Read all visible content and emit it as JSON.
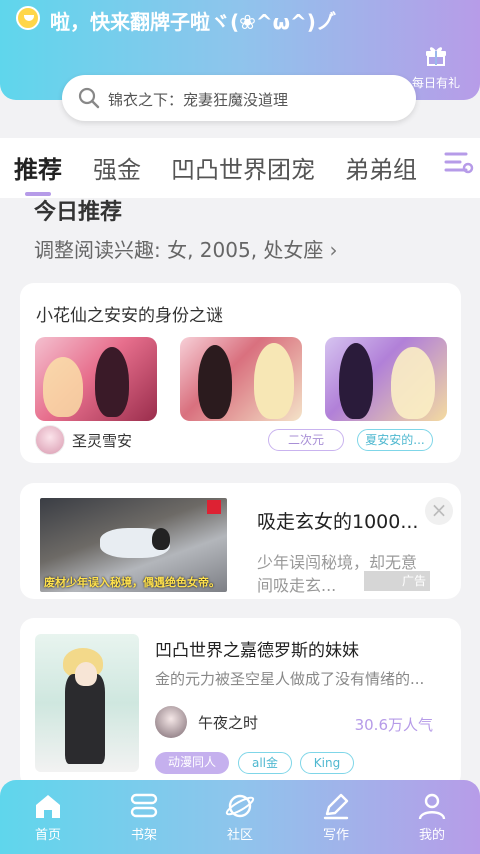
{
  "header": {
    "slogan": "啦，快来翻牌子啦ヾ(❀^ω^)ノ゙",
    "gift_label": "每日有礼"
  },
  "search": {
    "placeholder": "锦衣之下：宠妻狂魔没道理"
  },
  "tabs": [
    {
      "label": "推荐",
      "active": true
    },
    {
      "label": "强金",
      "active": false
    },
    {
      "label": "凹凸世界团宠",
      "active": false
    },
    {
      "label": "弟弟组",
      "active": false
    }
  ],
  "today": {
    "title": "今日推荐",
    "subtitle": "调整阅读兴趣: 女, 2005, 处女座"
  },
  "collection": {
    "title": "小花仙之安安的身份之谜",
    "author": "圣灵雪安",
    "tags": [
      "二次元",
      "夏安安的..."
    ]
  },
  "ad": {
    "title": "吸走玄女的1000...",
    "desc": "少年误闯秘境，却无意间吸走玄...",
    "caption": "废材少年误入秘境，偶遇绝色女帝。",
    "close": "×",
    "label": "广告"
  },
  "book": {
    "title": "凹凸世界之嘉德罗斯的妹妹",
    "desc": "金的元力被圣空星人做成了没有情绪的...",
    "author": "午夜之时",
    "popularity": "30.6万人气",
    "tags": [
      "动漫同人",
      "all金",
      "King"
    ]
  },
  "nav": [
    {
      "label": "首页",
      "icon": "home-icon"
    },
    {
      "label": "书架",
      "icon": "bookshelf-icon"
    },
    {
      "label": "社区",
      "icon": "planet-icon"
    },
    {
      "label": "写作",
      "icon": "pen-icon"
    },
    {
      "label": "我的",
      "icon": "user-icon"
    }
  ],
  "colors": {
    "gradient_start": "#5fd6ec",
    "gradient_end": "#b79ce8",
    "accent_purple": "#b69be8",
    "accent_cyan": "#4fb8d0"
  }
}
